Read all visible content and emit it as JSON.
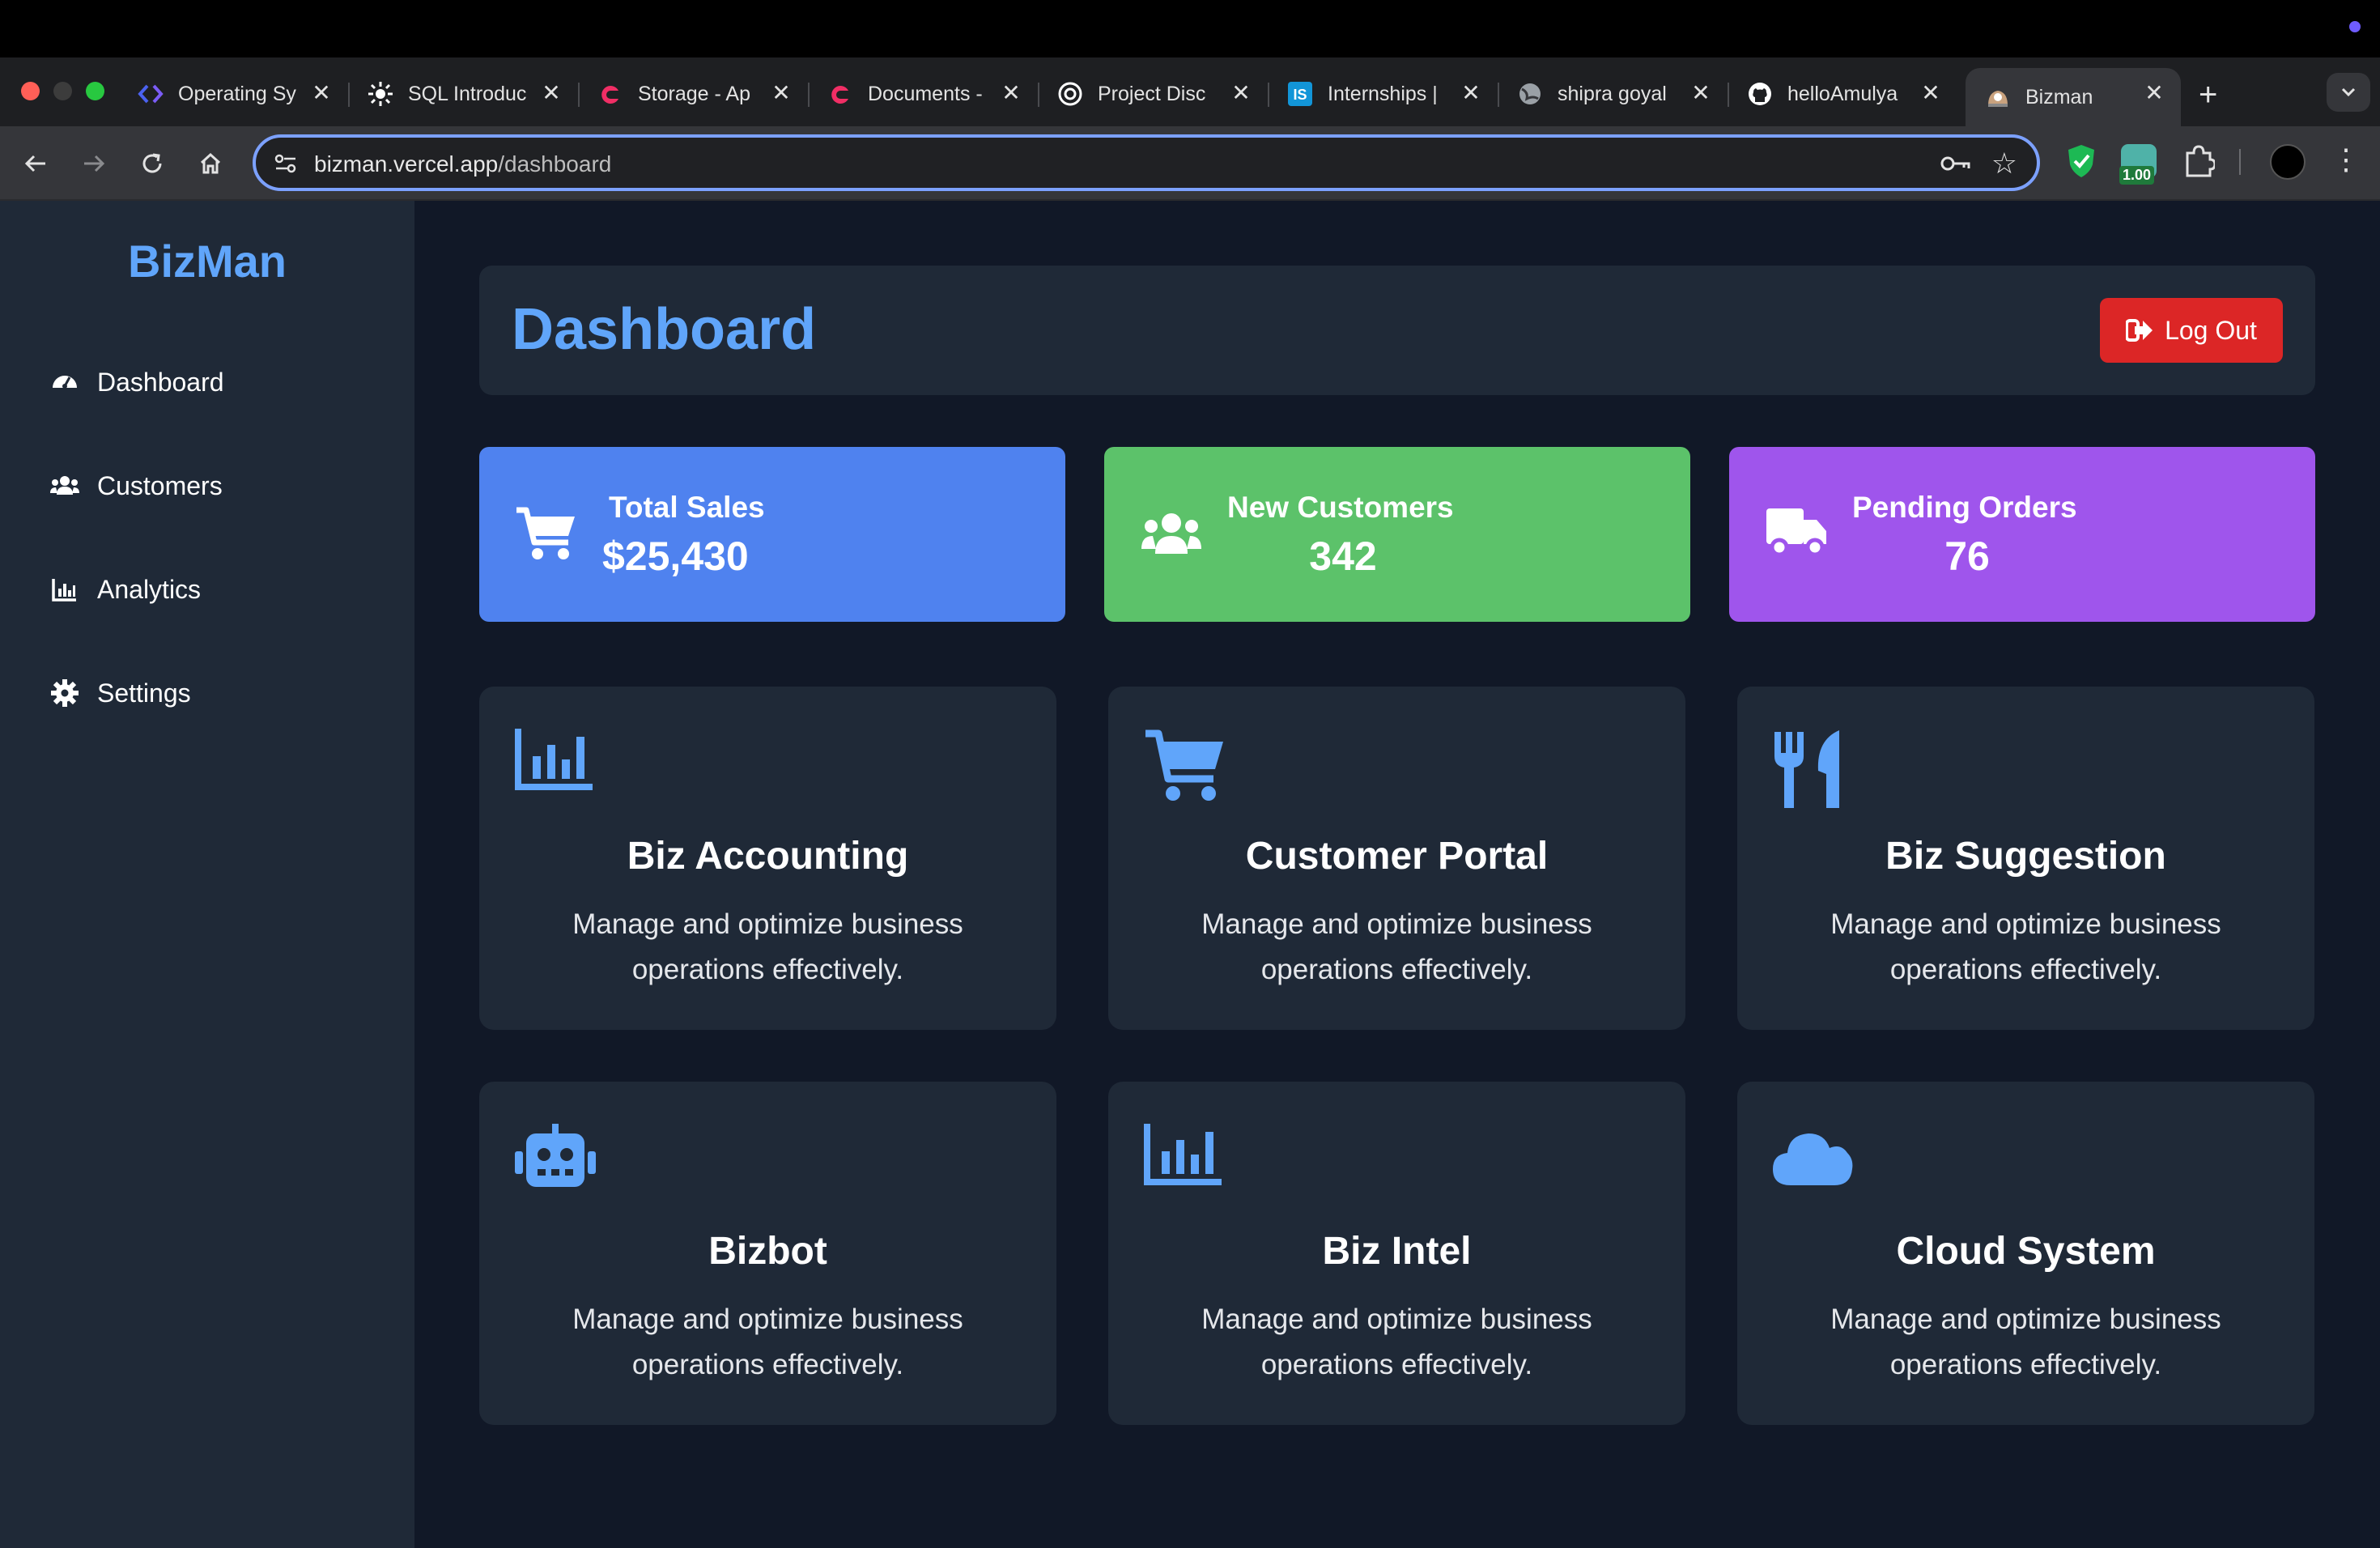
{
  "browser": {
    "tabs": [
      {
        "title": "Operating Sy",
        "icon": "code-icon"
      },
      {
        "title": "SQL Introduc",
        "icon": "sun-icon"
      },
      {
        "title": "Storage - Ap",
        "icon": "appwrite-icon"
      },
      {
        "title": "Documents -",
        "icon": "appwrite-icon"
      },
      {
        "title": "Project Disc",
        "icon": "openai-icon"
      },
      {
        "title": "Internships |",
        "icon": "internshala-icon"
      },
      {
        "title": "shipra goyal",
        "icon": "globe-icon"
      },
      {
        "title": "helloAmulya",
        "icon": "github-icon"
      },
      {
        "title": "Bizman",
        "icon": "bizman-icon"
      }
    ],
    "close_glyph": "✕",
    "new_tab_glyph": "+",
    "url_host": "bizman.vercel.app",
    "url_path": "/dashboard",
    "extension_badge": "1.00"
  },
  "sidebar": {
    "brand": "BizMan",
    "items": [
      {
        "label": "Dashboard",
        "icon": "gauge-icon"
      },
      {
        "label": "Customers",
        "icon": "users-icon"
      },
      {
        "label": "Analytics",
        "icon": "chart-icon"
      },
      {
        "label": "Settings",
        "icon": "gear-icon"
      }
    ]
  },
  "header": {
    "title": "Dashboard",
    "logout_label": "Log Out"
  },
  "stats": [
    {
      "label": "Total Sales",
      "value": "$25,430",
      "color": "#4f82ef",
      "icon": "cart-icon"
    },
    {
      "label": "New Customers",
      "value": "342",
      "color": "#5cc26a",
      "icon": "users-icon"
    },
    {
      "label": "Pending Orders",
      "value": "76",
      "color": "#9f55ec",
      "icon": "truck-icon"
    }
  ],
  "features": [
    {
      "title": "Biz Accounting",
      "description": "Manage and optimize business operations effectively.",
      "icon": "chart-icon"
    },
    {
      "title": "Customer Portal",
      "description": "Manage and optimize business operations effectively.",
      "icon": "cart-icon"
    },
    {
      "title": "Biz Suggestion",
      "description": "Manage and optimize business operations effectively.",
      "icon": "utensils-icon"
    },
    {
      "title": "Bizbot",
      "description": "Manage and optimize business operations effectively.",
      "icon": "robot-icon"
    },
    {
      "title": "Biz Intel",
      "description": "Manage and optimize business operations effectively.",
      "icon": "chart-icon"
    },
    {
      "title": "Cloud System",
      "description": "Manage and optimize business operations effectively.",
      "icon": "cloud-icon"
    }
  ],
  "colors": {
    "accent": "#60a5fa",
    "sidebar_bg": "#1f2937",
    "page_bg": "#111827",
    "logout_bg": "#dc2626"
  }
}
